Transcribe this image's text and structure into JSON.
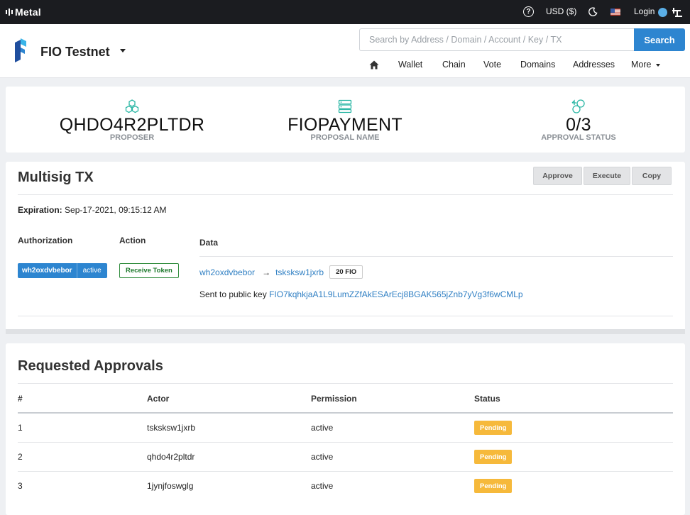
{
  "topbar": {
    "brand": "Metal",
    "currency": "USD ($)",
    "login": "Login"
  },
  "header": {
    "chain_name": "FIO Testnet",
    "search_placeholder": "Search by Address / Domain / Account / Key / TX",
    "search_button": "Search",
    "nav": {
      "wallet": "Wallet",
      "chain": "Chain",
      "vote": "Vote",
      "domains": "Domains",
      "addresses": "Addresses",
      "more": "More"
    }
  },
  "summary": {
    "proposer": {
      "value": "QHDO4R2PLTDR",
      "label": "PROPOSER"
    },
    "proposal_name": {
      "value": "FIOPAYMENT",
      "label": "PROPOSAL NAME"
    },
    "approval_status": {
      "value": "0/3",
      "label": "APPROVAL STATUS"
    }
  },
  "multisig": {
    "title": "Multisig TX",
    "buttons": {
      "approve": "Approve",
      "execute": "Execute",
      "copy": "Copy"
    },
    "expiration_label": "Expiration:",
    "expiration_value": "Sep-17-2021, 09:15:12 AM",
    "columns": {
      "authorization": "Authorization",
      "action": "Action",
      "data": "Data"
    },
    "authorization": {
      "actor": "wh2oxdvbebor",
      "permission": "active"
    },
    "action": "Receive Token",
    "data": {
      "from": "wh2oxdvbebor",
      "arrow": "→",
      "to": "tsksksw1jxrb",
      "amount": "20 FIO",
      "pubkey_prefix": "Sent to public key",
      "pubkey": "FIO7kqhkjaA1L9LumZZfAkESArEcj8BGAK565jZnb7yVg3f6wCMLp"
    }
  },
  "approvals": {
    "title": "Requested Approvals",
    "columns": {
      "num": "#",
      "actor": "Actor",
      "permission": "Permission",
      "status": "Status"
    },
    "rows": [
      {
        "num": "1",
        "actor": "tsksksw1jxrb",
        "permission": "active",
        "status": "Pending"
      },
      {
        "num": "2",
        "actor": "qhdo4r2pltdr",
        "permission": "active",
        "status": "Pending"
      },
      {
        "num": "3",
        "actor": "1jynjfoswglg",
        "permission": "active",
        "status": "Pending"
      }
    ]
  },
  "colors": {
    "accent": "#2d85d0",
    "pending": "#f6b93b",
    "success": "#2e8b3b",
    "topbar": "#1b1c20"
  }
}
